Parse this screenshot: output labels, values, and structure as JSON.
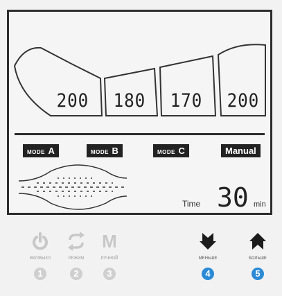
{
  "pressures": {
    "p1": "200",
    "p2": "180",
    "p3": "170",
    "p4": "200"
  },
  "modes": {
    "mode_a": {
      "prefix": "MODE",
      "letter": "A"
    },
    "mode_b": {
      "prefix": "MODE",
      "letter": "B"
    },
    "mode_c": {
      "prefix": "MODE",
      "letter": "C"
    },
    "manual": {
      "label": "Manual"
    }
  },
  "time": {
    "label": "Time",
    "value": "30",
    "unit": "min"
  },
  "buttons": [
    {
      "icon": "power-icon",
      "caption": "ВКЛ/ВЫКЛ",
      "number": "1",
      "active": false
    },
    {
      "icon": "cycle-icon",
      "caption": "РЕЖИМ",
      "number": "2",
      "active": false
    },
    {
      "icon": "m-icon",
      "glyph": "M",
      "caption": "РУЧНОЙ",
      "number": "3",
      "active": false
    },
    {
      "icon": "arrow-down-icon",
      "caption": "МЕНЬШЕ",
      "number": "4",
      "active": true
    },
    {
      "icon": "arrow-up-icon",
      "caption": "БОЛЬШЕ",
      "number": "5",
      "active": true
    }
  ],
  "colors": {
    "lcd_ink": "#222222",
    "accent": "#2b8ad6",
    "inactive": "#cfcfcf"
  }
}
